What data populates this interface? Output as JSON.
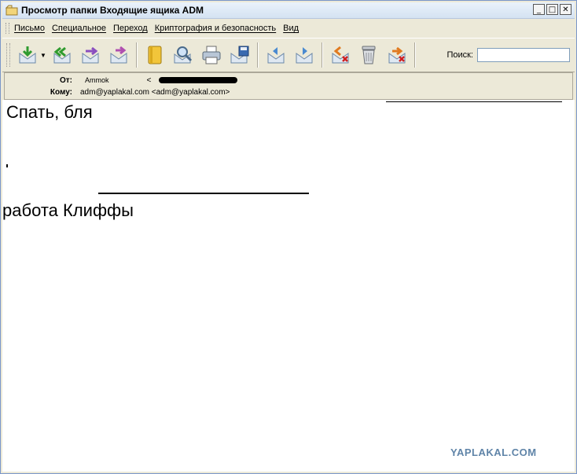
{
  "window": {
    "title": "Просмотр папки Входящие ящика ADM",
    "controls": {
      "minimize": "_",
      "maximize": "□",
      "close": "✕"
    }
  },
  "menu": {
    "items": [
      "Письмо",
      "Специальное",
      "Переход",
      "Криптография и безопасность",
      "Вид"
    ]
  },
  "toolbar": {
    "buttons": [
      "get-mail-icon",
      "reply-all-icon",
      "forward-icon",
      "forward-inline-icon",
      "address-book-icon",
      "find-icon",
      "print-icon",
      "save-icon",
      "move-up-icon",
      "move-down-icon",
      "delete-message-icon",
      "trash-icon",
      "delete-junk-icon"
    ],
    "search_label": "Поиск:",
    "search_value": ""
  },
  "headers": {
    "from_label": "От:",
    "from_name": "Ammok",
    "from_addr_open": "<",
    "to_label": "Кому:",
    "to_value": "adm@yaplakal.com <adm@yaplakal.com>"
  },
  "message": {
    "line1": "Спать, бля",
    "line2": "работа Клиффы"
  },
  "watermark": "YAPLAKAL.COM",
  "colors": {
    "titlebar": "#d4e2f2",
    "chrome": "#ece9d8",
    "watermark": "#5f84a8"
  }
}
